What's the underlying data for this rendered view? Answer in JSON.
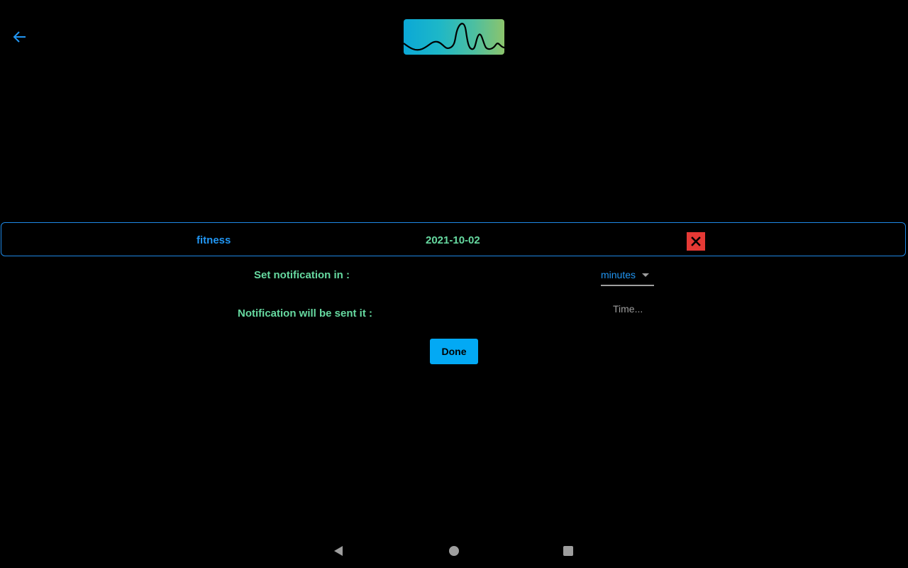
{
  "header": {
    "back_icon": "arrow-left-icon",
    "logo_icon": "waveform-logo-icon"
  },
  "entry": {
    "category": "fitness",
    "date": "2021-10-02",
    "delete_icon": "close-icon"
  },
  "notification": {
    "set_label": "Set notification in :",
    "unit_value": "minutes",
    "sent_label": "Notification will be sent it :",
    "time_placeholder": "Time..."
  },
  "actions": {
    "done_label": "Done"
  },
  "system_nav": {
    "back_icon": "triangle-back-icon",
    "home_icon": "circle-home-icon",
    "recents_icon": "square-recents-icon"
  },
  "colors": {
    "accent": "#2196f3",
    "label_green": "#66d9a0",
    "delete_red": "#e53935",
    "button_blue": "#03a9f4",
    "background": "#000000"
  }
}
